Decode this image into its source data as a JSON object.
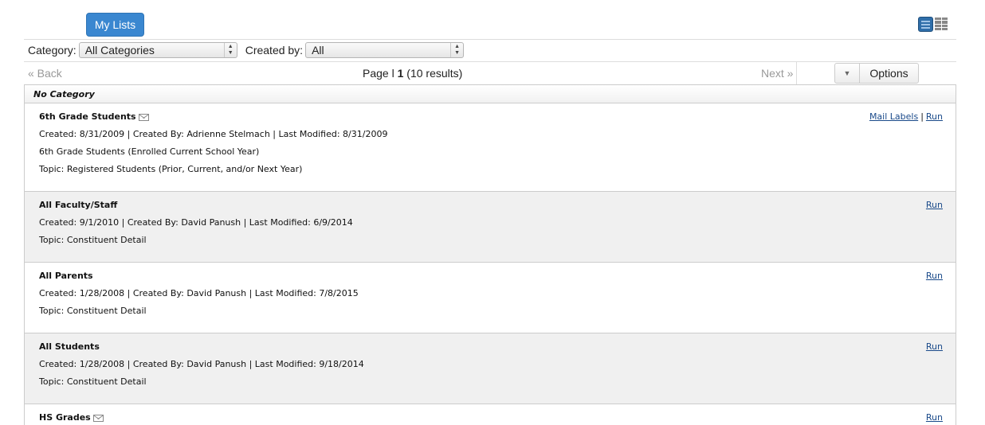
{
  "header": {
    "tab_label": "My Lists"
  },
  "filters": {
    "category_label": "Category:",
    "category_value": "All Categories",
    "created_by_label": "Created by:",
    "created_by_value": "All"
  },
  "pager": {
    "back": "« Back",
    "page_prefix": "Page l",
    "page_number": "1",
    "results": "(10 results)",
    "next": "Next »",
    "options": "Options"
  },
  "category": "No Category",
  "items": [
    {
      "title": "6th Grade Students",
      "meta": "Created: 8/31/2009 | Created By: Adrienne Stelmach | Last Modified: 8/31/2009",
      "description": "6th Grade Students (Enrolled Current School Year)",
      "topic": "Topic: Registered Students (Prior, Current, and/or Next Year)",
      "mail_labels": "Mail Labels",
      "sep": "|",
      "run": "Run"
    },
    {
      "title": "All Faculty/Staff",
      "meta": "Created: 9/1/2010 | Created By: David Panush | Last Modified: 6/9/2014",
      "topic": "Topic: Constituent Detail",
      "run": "Run"
    },
    {
      "title": "All Parents",
      "meta": "Created: 1/28/2008 | Created By: David Panush | Last Modified: 7/8/2015",
      "topic": "Topic: Constituent Detail",
      "run": "Run"
    },
    {
      "title": "All Students",
      "meta": "Created: 1/28/2008 | Created By: David Panush | Last Modified: 9/18/2014",
      "topic": "Topic: Constituent Detail",
      "run": "Run"
    },
    {
      "title": "HS Grades",
      "run": "Run"
    }
  ]
}
